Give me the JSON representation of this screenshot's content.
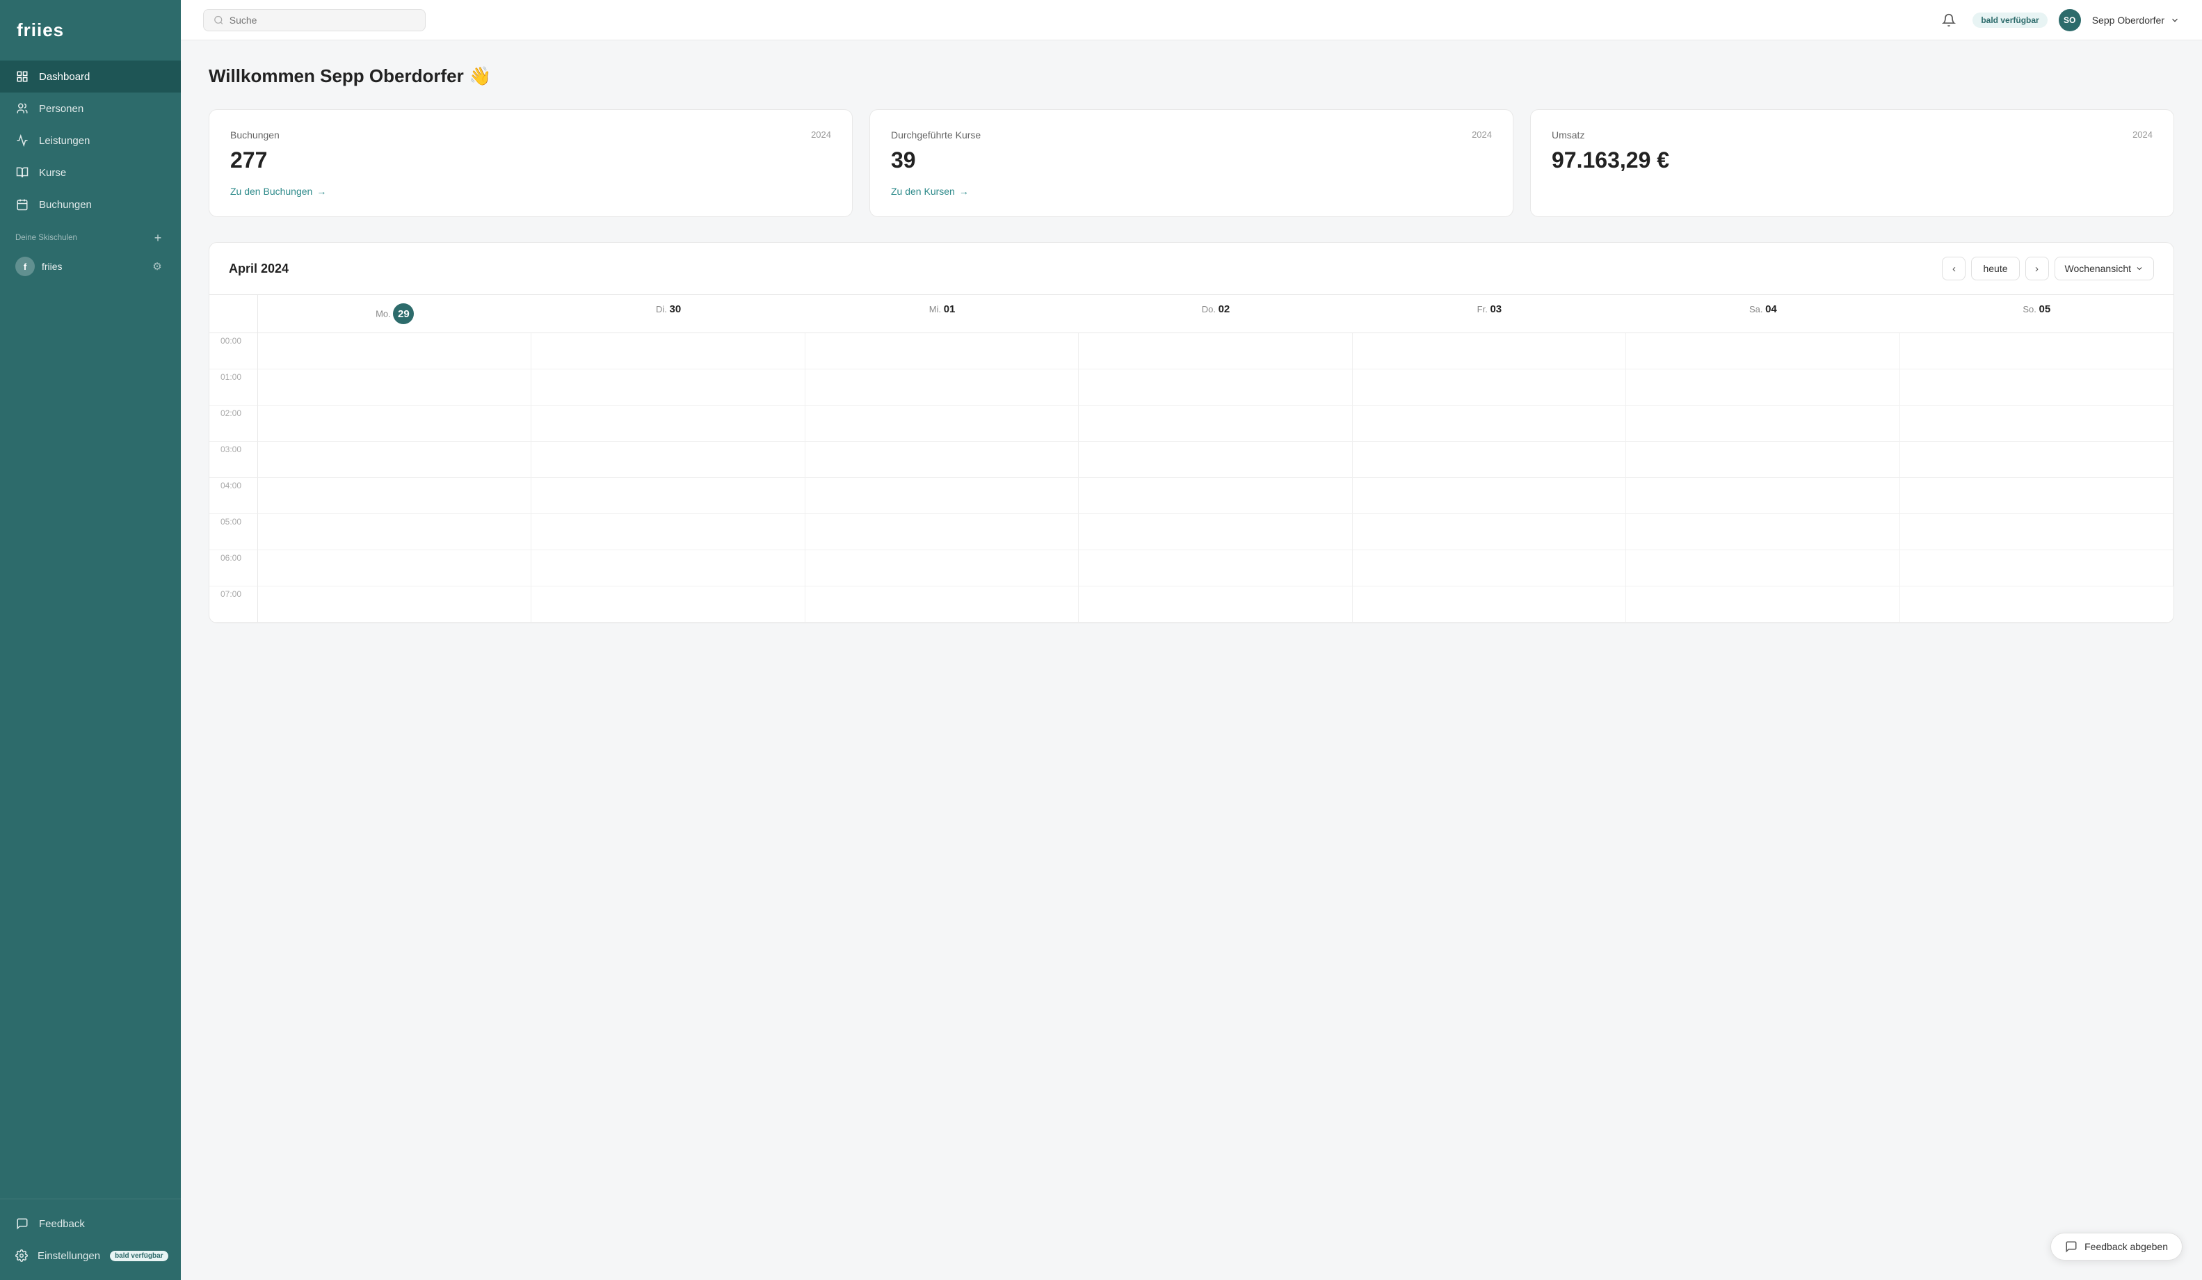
{
  "sidebar": {
    "logo": "friies",
    "nav_items": [
      {
        "id": "dashboard",
        "label": "Dashboard",
        "active": true
      },
      {
        "id": "personen",
        "label": "Personen",
        "active": false
      },
      {
        "id": "leistungen",
        "label": "Leistungen",
        "active": false
      },
      {
        "id": "kurse",
        "label": "Kurse",
        "active": false
      },
      {
        "id": "buchungen",
        "label": "Buchungen",
        "active": false
      }
    ],
    "section_label": "Deine Skischulen",
    "ski_school": {
      "initial": "f",
      "name": "friies"
    },
    "bottom_items": [
      {
        "id": "feedback",
        "label": "Feedback"
      },
      {
        "id": "einstellungen",
        "label": "Einstellungen",
        "badge": "bald verfügbar"
      }
    ]
  },
  "topbar": {
    "search_placeholder": "Suche",
    "status_pill": "bald verfügbar",
    "user_initials": "SO",
    "user_name": "Sepp Oberdorfer"
  },
  "welcome": {
    "greeting": "Willkommen Sepp Oberdorfer 👋"
  },
  "stats": [
    {
      "label": "Buchungen",
      "year": "2024",
      "value": "277",
      "link_text": "Zu den Buchungen",
      "link_arrow": "→"
    },
    {
      "label": "Durchgeführte Kurse",
      "year": "2024",
      "value": "39",
      "link_text": "Zu den Kursen",
      "link_arrow": "→"
    },
    {
      "label": "Umsatz",
      "year": "2024",
      "value": "97.163,29 €",
      "link_text": "",
      "link_arrow": ""
    }
  ],
  "calendar": {
    "title": "April 2024",
    "today_btn": "heute",
    "view_btn": "Wochenansicht",
    "days": [
      {
        "abbr": "Mo.",
        "num": "29",
        "today": true
      },
      {
        "abbr": "Di.",
        "num": "30",
        "today": false
      },
      {
        "abbr": "Mi.",
        "num": "01",
        "today": false
      },
      {
        "abbr": "Do.",
        "num": "02",
        "today": false
      },
      {
        "abbr": "Fr.",
        "num": "03",
        "today": false
      },
      {
        "abbr": "Sa.",
        "num": "04",
        "today": false
      },
      {
        "abbr": "So.",
        "num": "05",
        "today": false
      }
    ],
    "time_slots": [
      "00:00",
      "01:00",
      "02:00",
      "03:00",
      "04:00",
      "05:00",
      "06:00",
      "07:00"
    ]
  },
  "feedback_button": "Feedback abgeben"
}
